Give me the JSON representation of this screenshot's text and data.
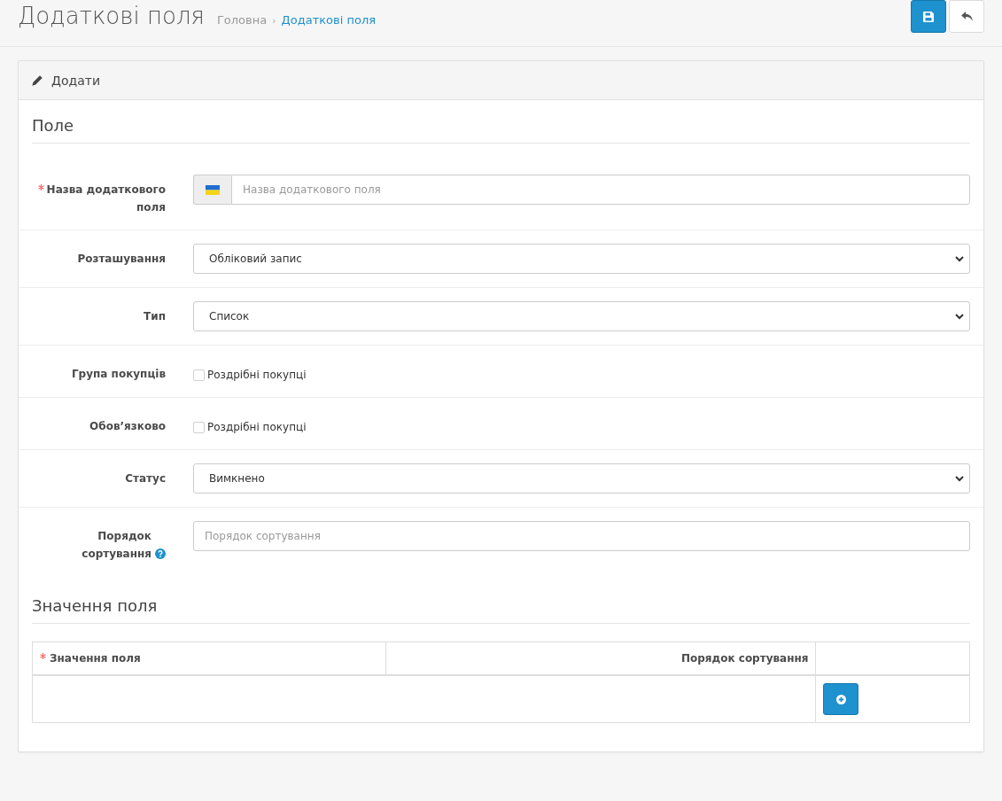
{
  "header": {
    "title": "Додаткові поля",
    "breadcrumbs": [
      {
        "label": "Головна",
        "current": false
      },
      {
        "label": "Додаткові поля",
        "current": true
      }
    ],
    "breadcrumb_separator": "›",
    "actions": [
      {
        "kind": "save"
      },
      {
        "kind": "back"
      }
    ]
  },
  "panel": {
    "title": "Додати",
    "sections": [
      {
        "legend": "Поле",
        "fields": [
          {
            "kind": "language_text",
            "label": "Назва додаткового поля",
            "required": true,
            "help": false,
            "placeholder": "Назва додаткового поля"
          },
          {
            "kind": "select",
            "label": "Розташування",
            "required": false,
            "help": false,
            "value": "Обліковий запис"
          },
          {
            "kind": "select",
            "label": "Тип",
            "required": false,
            "help": false,
            "value": "Список"
          },
          {
            "kind": "checkboxes",
            "label": "Група покупців",
            "required": false,
            "help": false,
            "options": [
              {
                "label": "Роздрібні покупці",
                "checked": false
              }
            ]
          },
          {
            "kind": "checkboxes",
            "label": "Обов’язково",
            "required": false,
            "help": false,
            "options": [
              {
                "label": "Роздрібні покупці",
                "checked": false
              }
            ]
          },
          {
            "kind": "select",
            "label": "Статус",
            "required": false,
            "help": false,
            "value": "Вимкнено"
          },
          {
            "kind": "text",
            "label": "Порядок сортування",
            "required": false,
            "help": true,
            "placeholder": "Порядок сортування"
          }
        ]
      },
      {
        "legend": "Значення поля",
        "table": {
          "columns": [
            {
              "kind": "text",
              "label": "Значення поля",
              "required": true
            },
            {
              "kind": "text",
              "label": "Порядок сортування",
              "required": false
            },
            {
              "kind": "action"
            }
          ],
          "footer_actions": [
            {
              "kind": "add"
            }
          ]
        }
      }
    ]
  }
}
